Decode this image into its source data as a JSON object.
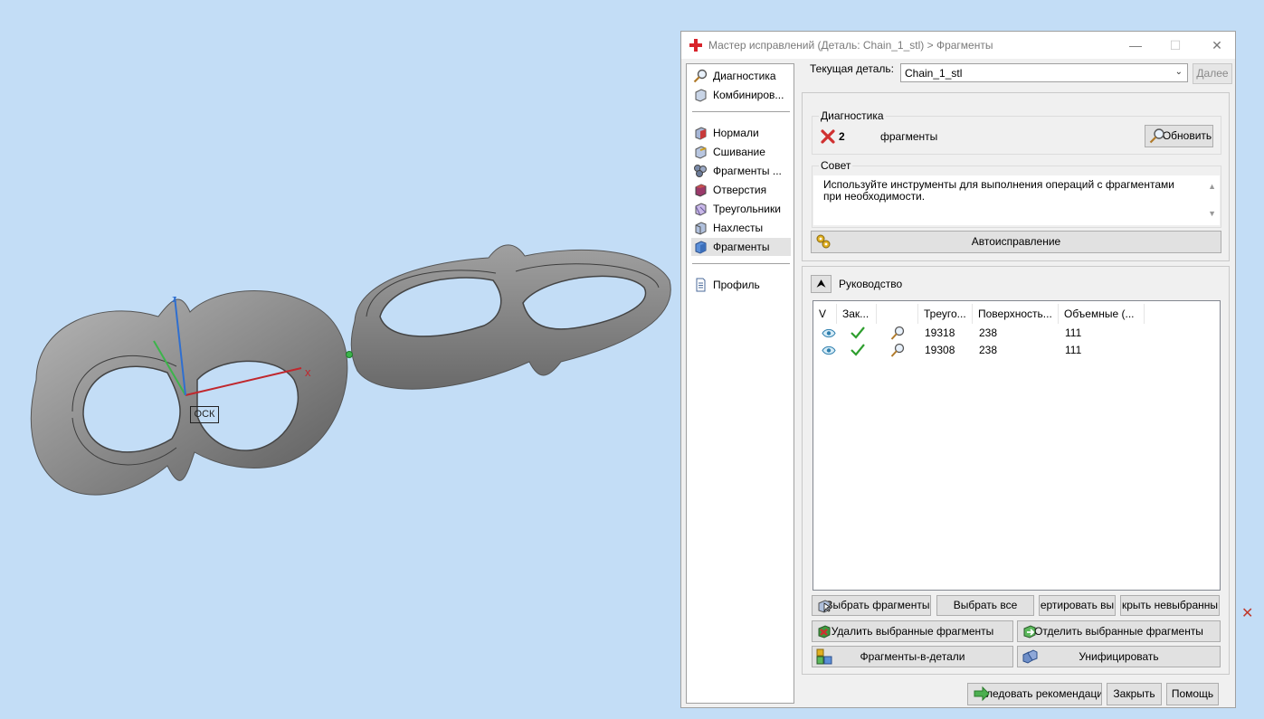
{
  "viewport": {
    "ocs_label": "ОСК",
    "axis_x_label": "x",
    "axis_z_label": "z",
    "stray_marker": "✕"
  },
  "dialog": {
    "title": "Мастер исправлений (Деталь: Chain_1_stl) > Фрагменты",
    "icon": "red-cross-icon",
    "window_buttons": {
      "minimize": "—",
      "maximize": "☐",
      "close": "✕"
    }
  },
  "nav": {
    "top_items": [
      {
        "label": "Диагностика",
        "icon": "magnifier-icon"
      },
      {
        "label": "Комбиниров...",
        "icon": "combine-cube-icon"
      }
    ],
    "mid_items": [
      {
        "label": "Нормали",
        "icon": "normals-cube-icon"
      },
      {
        "label": "Сшивание",
        "icon": "stitch-cube-icon"
      },
      {
        "label": "Фрагменты ...",
        "icon": "shells-cube-icon"
      },
      {
        "label": "Отверстия",
        "icon": "holes-cube-icon"
      },
      {
        "label": "Треугольники",
        "icon": "triangles-cube-icon"
      },
      {
        "label": "Нахлесты",
        "icon": "overlaps-cube-icon"
      },
      {
        "label": "Фрагменты",
        "icon": "fragments-cube-icon",
        "active": true
      }
    ],
    "bottom_items": [
      {
        "label": "Профиль",
        "icon": "document-icon"
      }
    ]
  },
  "current_part": {
    "label": "Текущая деталь:",
    "value": "Chain_1_stl",
    "next_button": "Далее"
  },
  "diagnostics": {
    "group_title": "Диагностика",
    "count": "2",
    "text": "фрагменты",
    "refresh_button": "Обновить"
  },
  "advice": {
    "group_title": "Совет",
    "text": "Используйте инструменты для выполнения операций с фрагментами при необходимости."
  },
  "autofix_button": "Автоисправление",
  "guide": {
    "toggle_glyph": "⮝",
    "label": "Руководство"
  },
  "table": {
    "headers": [
      "V",
      "Зак...",
      "",
      "Треуго...",
      "Поверхность...",
      "Объемные (..."
    ],
    "rows": [
      {
        "triangles": "19318",
        "surface": "238",
        "volume": "111"
      },
      {
        "triangles": "19308",
        "surface": "238",
        "volume": "111"
      }
    ]
  },
  "actions": {
    "select_fragments": "Выбрать фрагменты",
    "select_all": "Выбрать все",
    "invert": "ертировать вы",
    "hide_unselected": "крыть невыбранны",
    "delete_selected": "Удалить выбранные фрагменты",
    "detach_selected": "Отделить выбранные фрагменты",
    "fragments_to_parts": "Фрагменты-в-детали",
    "unify": "Унифицировать"
  },
  "footer": {
    "follow": "ледовать рекомендациям",
    "close": "Закрыть",
    "help": "Помощь"
  },
  "colors": {
    "background": "#c3ddf6",
    "model": "#8c8c8c",
    "axis_x": "#c0272d",
    "axis_y": "#3cb44b",
    "axis_z": "#2f6fd0",
    "check": "#2e9e2e",
    "error": "#d03030"
  }
}
